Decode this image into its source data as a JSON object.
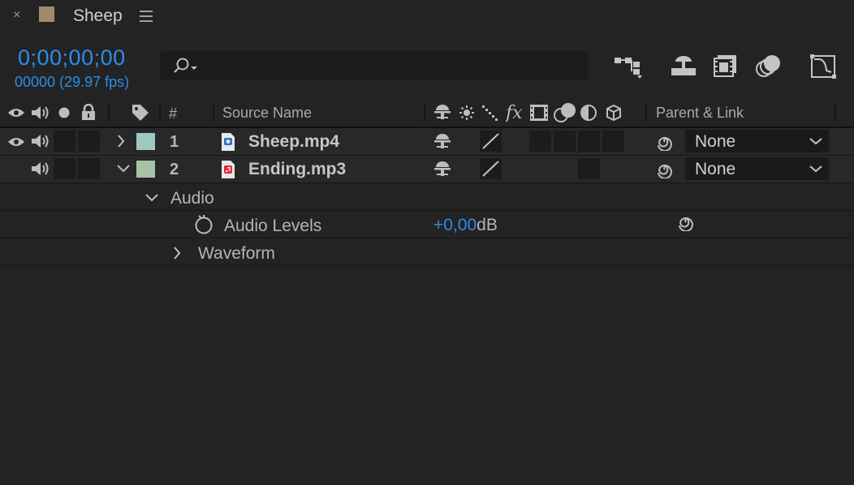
{
  "tab": {
    "close": "×",
    "title": "Sheep",
    "swatch_color": "#a08a6c"
  },
  "timecode": {
    "value": "0;00;00;00",
    "frames": "00000 (29.97 fps)"
  },
  "search": {
    "placeholder": ""
  },
  "header": {
    "number": "#",
    "source_name": "Source Name",
    "parent_link": "Parent & Link"
  },
  "layers": [
    {
      "number": "1",
      "name": "Sheep.mp4",
      "label_color": "#9ec9c3",
      "parent": "None",
      "expanded": false
    },
    {
      "number": "2",
      "name": "Ending.mp3",
      "label_color": "#a6c3a6",
      "parent": "None",
      "expanded": true
    }
  ],
  "properties": {
    "audio": "Audio",
    "audio_levels": {
      "label": "Audio Levels",
      "value": "+0,00",
      "unit": "dB"
    },
    "waveform": "Waveform"
  }
}
